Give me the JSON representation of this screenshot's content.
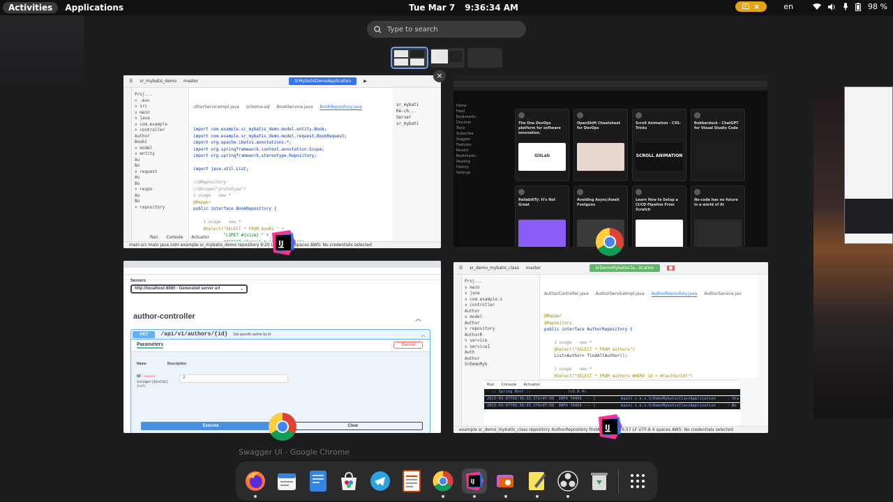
{
  "topbar": {
    "activities": "Activities",
    "applications": "Applications",
    "date": "Tue Mar 7",
    "time": "9:36:34 AM",
    "lang": "en",
    "battery": "98 %",
    "indicator_close": "×"
  },
  "search": {
    "placeholder": "Type to search"
  },
  "windows": {
    "ide1": {
      "project": "sr_mybatis_demo",
      "branch": "master",
      "run_config": "SrMybatisDemoApplication",
      "tabs": [
        "uthorServiceImpl.java",
        "schema.sql",
        "BookService.java",
        "BookRepository.java"
      ],
      "tree": [
        "Proj...",
        "> .mvn",
        "v src",
        "  v main",
        "    v java",
        "      v com.example",
        "        > controller",
        "          Author",
        "          BookC",
        "        v model",
        "          v entity",
        "            Au",
        "            Bo",
        "          v request",
        "            Au",
        "            Bo",
        "          > respo",
        "            Au",
        "            Bo",
        "        > repository"
      ],
      "code": [
        "import com.example.sr_mybatis_demo.model.entity.Book;",
        "import com.example.sr_mybatis_demo.model.request.BookRequest;",
        "import org.apache.ibatis.annotations.*;",
        "import org.springframework.context.annotation.Scope;",
        "import org.springframework.stereotype.Repository;",
        "",
        "import java.util.List;",
        "",
        "//@Repository",
        "//@Scope(\"prototype\")",
        "1 usage   new *",
        "@Mapper",
        "public interface BookRepository {",
        "",
        "    1 usage   new *",
        "    @Select(\"SELECT * FROM books \" +",
        "            \"LIMIT #{size} \" +",
        "            \"OFFSET #{size} * (#{page} -1)\")"
      ],
      "right": [
        "sr_mybati",
        "Re-ch...",
        "Server",
        "sr_mybati"
      ],
      "bottom_tabs": [
        "Run",
        "Console",
        "Actuator"
      ],
      "status": "main  src  main  java  com  example  sr_mybatis_demo  repository  9:20  LF  UTF-8  4 spaces  AWS: No credentials selected"
    },
    "chrome_dark": {
      "nav": [
        "Home",
        "Feed",
        "Bookmarks",
        "Discover",
        "Tools",
        "Subscribe",
        "Suggest Features",
        "Recent",
        "Bookmarks",
        "Reading History",
        "Settings"
      ],
      "cards": [
        {
          "title": "The One DevOps platform for software innovation.",
          "thumb": "GitLab",
          "color": "#ffffff"
        },
        {
          "title": "OpenShift Cheatsheet for DevOps",
          "thumb": "",
          "color": "#e8d7d0"
        },
        {
          "title": "Scroll Animation - CSS-Tricks",
          "thumb": "SCROLL ANIMATION",
          "color": "#111111"
        },
        {
          "title": "Rubberduck - ChatGPT for Visual Studio Code",
          "thumb": "",
          "color": "#1e1e1e"
        },
        {
          "title": "ReliabiliTy: It's Not Great",
          "thumb": "",
          "color": "#8a5cf5"
        },
        {
          "title": "Avoiding Async/Await Footguns",
          "thumb": "",
          "color": "#3a3a3a"
        },
        {
          "title": "Learn How to Setup a CI/CD Pipeline From Scratch",
          "thumb": "",
          "color": "#ffffff"
        },
        {
          "title": "No-code has no future in a world of AI",
          "thumb": "",
          "color": "#2a2a2a"
        }
      ]
    },
    "swagger": {
      "servers_label": "Servers",
      "server_value": "http://localhost:8080 - Generated server url",
      "controller": "author-controller",
      "method": "GET",
      "path": "/api/v1/authors/{id}",
      "summary": "Get specific author by id",
      "params_label": "Parameters",
      "cancel": "Cancel",
      "col_name": "Name",
      "col_desc": "Description",
      "param_name": "id",
      "param_required": "* required",
      "param_type": "integer($int32)",
      "param_in": "(path)",
      "param_value": "2",
      "execute": "Execute",
      "clear": "Clear"
    },
    "ide2": {
      "project": "sr_demo_mybatis_class",
      "branch": "master",
      "run_config": "SrDemoMybatisCla...lication",
      "tabs": [
        "AuthorController.java",
        "AuthorServiceImpl.java",
        "AuthorRepository.java",
        "AuthorService.jav"
      ],
      "tree": [
        "Proj...",
        "  v main",
        "    v java",
        "      v com.example.s",
        "        v controller",
        "            Author",
        "        v model",
        "            Author",
        "        v repository",
        "            AuthorR",
        "        v service",
        "          v serviceI",
        "              Auth",
        "            Author",
        "        SrDemoMyb"
      ],
      "code": [
        "@Mapper",
        "@Repository",
        "public interface AuthorRepository {",
        "",
        "    1 usage   new *",
        "    @Select(\"SELECT * FROM authors\")",
        "    List<Author> findAllAuthor();",
        "",
        "    1 usage   new *",
        "    @Select(\"SELECT * FROM authors WHERE id = #{authorId}\")",
        "    Author findAuthorById(Integer authorId);"
      ],
      "console_tabs": [
        "Run",
        "Console",
        "Actuator"
      ],
      "log": [
        "  :: Spring Boot ::                (v3.0.4)",
        "2023-03-07T09:36:33.372+07:00  INFO 70456 --- [           main] c.e.s.SrDemoMybatisClassApplication     : Sta",
        "2023-03-07T09:36:33.376+07:00  INFO 70456 --- [           main] c.e.s.SrDemoMybatisClassApplication     : No"
      ],
      "status": "example  sr_demo_mybatis_class  repository  AuthorRepository  findAuthorByI  16:57  LF  UTF-8  4 spaces  AWS: No credentials selected"
    }
  },
  "caption": "Swagger UI - Google Chrome",
  "dock": [
    "Firefox",
    "Calendar",
    "Text Editor",
    "Software",
    "Telegram",
    "Document Viewer",
    "Google Chrome",
    "IntelliJ IDEA",
    "Screenshot",
    "Notes",
    "OBS Studio",
    "Trash",
    "Show Applications"
  ]
}
